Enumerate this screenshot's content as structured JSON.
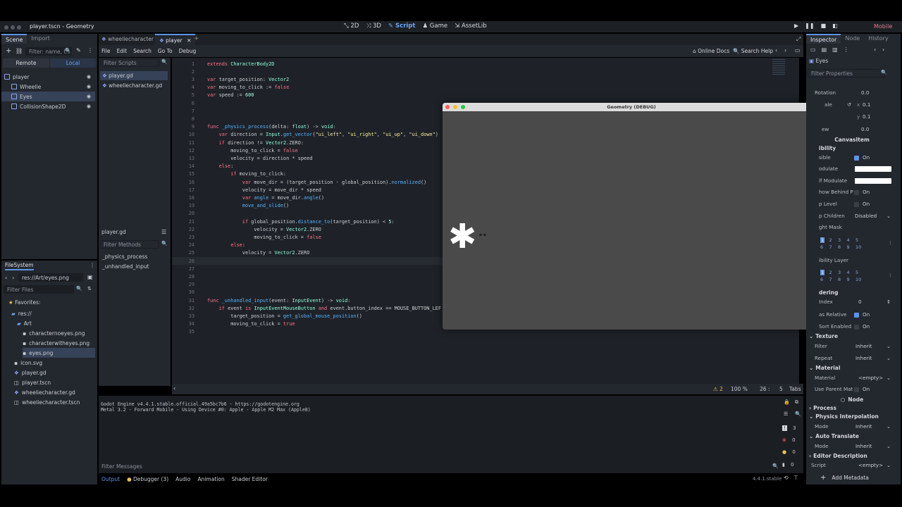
{
  "window": {
    "title": "player.tscn - Geometry"
  },
  "modes": [
    {
      "icon": "2d-icon",
      "label": "2D"
    },
    {
      "icon": "3d-icon",
      "label": "3D"
    },
    {
      "icon": "script-icon",
      "label": "Script"
    },
    {
      "icon": "game-icon",
      "label": "Game"
    },
    {
      "icon": "assetlib-icon",
      "label": "AssetLib"
    }
  ],
  "renderer": "Mobile",
  "scene_dock": {
    "tabs": [
      "Scene",
      "Import"
    ],
    "filter_placeholder": "Filter: name, t:t",
    "remote_label": "Remote",
    "local_label": "Local",
    "nodes": [
      {
        "name": "player",
        "color": "#8da5f3"
      },
      {
        "name": "Wheelie",
        "color": "#8da5f3"
      },
      {
        "name": "Eyes",
        "color": "#8da5f3"
      },
      {
        "name": "CollisionShape2D",
        "color": "#8da5f3"
      }
    ]
  },
  "filesystem": {
    "title": "FileSystem",
    "path": "res://Art/eyes.png",
    "filter_placeholder": "Filter Files",
    "favorites": "Favorites:",
    "items": [
      {
        "name": "res://",
        "type": "folder"
      },
      {
        "name": "Art",
        "type": "folder"
      },
      {
        "name": "characternoeyes.png",
        "type": "image"
      },
      {
        "name": "characterwitheyes.png",
        "type": "image"
      },
      {
        "name": "eyes.png",
        "type": "image"
      },
      {
        "name": "icon.svg",
        "type": "image"
      },
      {
        "name": "player.gd",
        "type": "script"
      },
      {
        "name": "player.tscn",
        "type": "scene"
      },
      {
        "name": "wheeliecharacter.gd",
        "type": "script"
      },
      {
        "name": "wheeliecharacter.tscn",
        "type": "scene"
      }
    ]
  },
  "editor_tabs": [
    "wheeliecharacter",
    "player"
  ],
  "script_menu": [
    "File",
    "Edit",
    "Search",
    "Go To",
    "Debug"
  ],
  "script_toolbar": {
    "online_docs": "Online Docs",
    "search_help": "Search Help"
  },
  "script_list": {
    "filter_placeholder": "Filter Scripts",
    "scripts": [
      "player.gd",
      "wheeliecharacter.gd"
    ],
    "current": "player.gd",
    "methods_placeholder": "Filter Methods",
    "methods": [
      "_physics_process",
      "_unhandled_input"
    ]
  },
  "code_lines": [
    "extends CharacterBody2D",
    "",
    "var target_position: Vector2",
    "var moving_to_click := false",
    "var speed := 600",
    "",
    "",
    "",
    "func _physics_process(delta: float) -> void:",
    "    var direction = Input.get_vector(\"ui_left\", \"ui_right\", \"ui_up\", \"ui_down\")",
    "    if direction != Vector2.ZERO:",
    "        moving_to_click = false",
    "        velocity = direction * speed",
    "    else:",
    "        if moving_to_click:",
    "            var move_dir = (target_position - global_position).normalized()",
    "            velocity = move_dir * speed",
    "            var angle = move_dir.angle()",
    "            move_and_slide()",
    "",
    "            if global_position.distance_to(target_position) < 5:",
    "                velocity = Vector2.ZERO",
    "                moving_to_click = false",
    "        else:",
    "            velocity = Vector2.ZERO",
    "",
    "",
    "",
    "",
    "",
    "func _unhandled_input(event: InputEvent) -> void:",
    "    if event is InputEventMouseButton and event.button_index == MOUSE_BUTTON_LEF",
    "        target_position = get_global_mouse_position()",
    "        moving_to_click = true",
    ""
  ],
  "status": {
    "warnings": "2",
    "zoom": "100 %",
    "line": "26",
    "col": "5",
    "indent": "Tabs"
  },
  "debug_window": {
    "title": "Geometry (DEBUG)"
  },
  "output": {
    "lines": [
      "Godot Engine v4.4.1.stable.official.49a5bc7b6 - https://godotengine.org",
      "Metal 3.2 - Forward Mobile - Using Device #0: Apple - Apple M2 Max (Apple8)"
    ],
    "filter_placeholder": "Filter Messages",
    "counts": {
      "info": "3",
      "errors": "0",
      "warnings": "0",
      "messages": "0"
    }
  },
  "bottom_tabs": [
    "Output",
    "Debugger (3)",
    "Audio",
    "Animation",
    "Shader Editor"
  ],
  "version": "4.4.1.stable",
  "inspector": {
    "tabs": [
      "Inspector",
      "Node",
      "History"
    ],
    "object": "Eyes",
    "filter_placeholder": "Filter Properties",
    "rotation_label": "Rotation",
    "rotation": "0.0",
    "scale_label": "ale",
    "scale_x": "0.1",
    "scale_y": "0.1",
    "skew_label": "ew",
    "skew": "0.0",
    "canvasitem": "CanvasItem",
    "visibility": "ibility",
    "visible_label": "sible",
    "on": "On",
    "modulate_label": "odulate",
    "self_modulate_label": "lf Modulate",
    "show_behind_label": "how Behind P",
    "top_level_label": "p Level",
    "clip_children_label": "p Children",
    "clip_children": "Disabled",
    "light_mask_label": "ght Mask",
    "mask_nums": [
      "1",
      "2",
      "3",
      "4",
      "5",
      "6",
      "7",
      "8",
      "9",
      "10"
    ],
    "visibility_layer_label": "ibility Layer",
    "ordering": "dering",
    "z_index_label": "Index",
    "z_index": "0",
    "z_relative_label": "as Relative",
    "y_sort_label": "Sort Enabled",
    "texture": "Texture",
    "filter_label": "Filter",
    "filter": "Inherit",
    "repeat_label": "Repeat",
    "repeat": "Inherit",
    "material_section": "Material",
    "material_label": "Material",
    "material": "<empty>",
    "use_parent_label": "Use Parent Mat",
    "node_section": "Node",
    "process": "Process",
    "physics_interp": "Physics Interpolation",
    "mode_label": "Mode",
    "mode": "Inherit",
    "auto_translate": "Auto Translate",
    "editor_desc": "Editor Description",
    "script_label": "Script",
    "script": "<empty>",
    "add_metadata": "Add Metadata"
  }
}
